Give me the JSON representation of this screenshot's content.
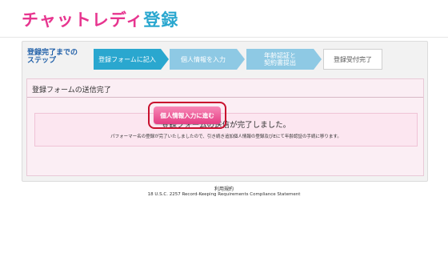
{
  "header": {
    "logo_part1": "チャットレディ",
    "logo_part2": "登録"
  },
  "steps": {
    "done_label": "登録完了までの\nステップ",
    "items": [
      {
        "label": "登録フォームに記入"
      },
      {
        "label": "個人情報を入力"
      },
      {
        "label": "年齢認証と\n契約書提出"
      },
      {
        "label": "登録受付完了"
      }
    ]
  },
  "section": {
    "title": "登録フォームの送信完了"
  },
  "message": {
    "line1": "登録フォームの送信が完了しました。",
    "line2": "パフォーマー名の登録が完了いたしましたので、引き続き追加個人情報の登録及びEにて年齢認証の手続に移ります。"
  },
  "cta": {
    "label": "個人情報入力に進む"
  },
  "footer": {
    "terms_link": "利用規約",
    "usc_link": "18 U.S.C. 2257 Record-Keeping Requirements Compliance Statement"
  },
  "colors": {
    "pink": "#e7358f",
    "blue": "#2aa7cf",
    "highlight_red": "#c8102e"
  }
}
